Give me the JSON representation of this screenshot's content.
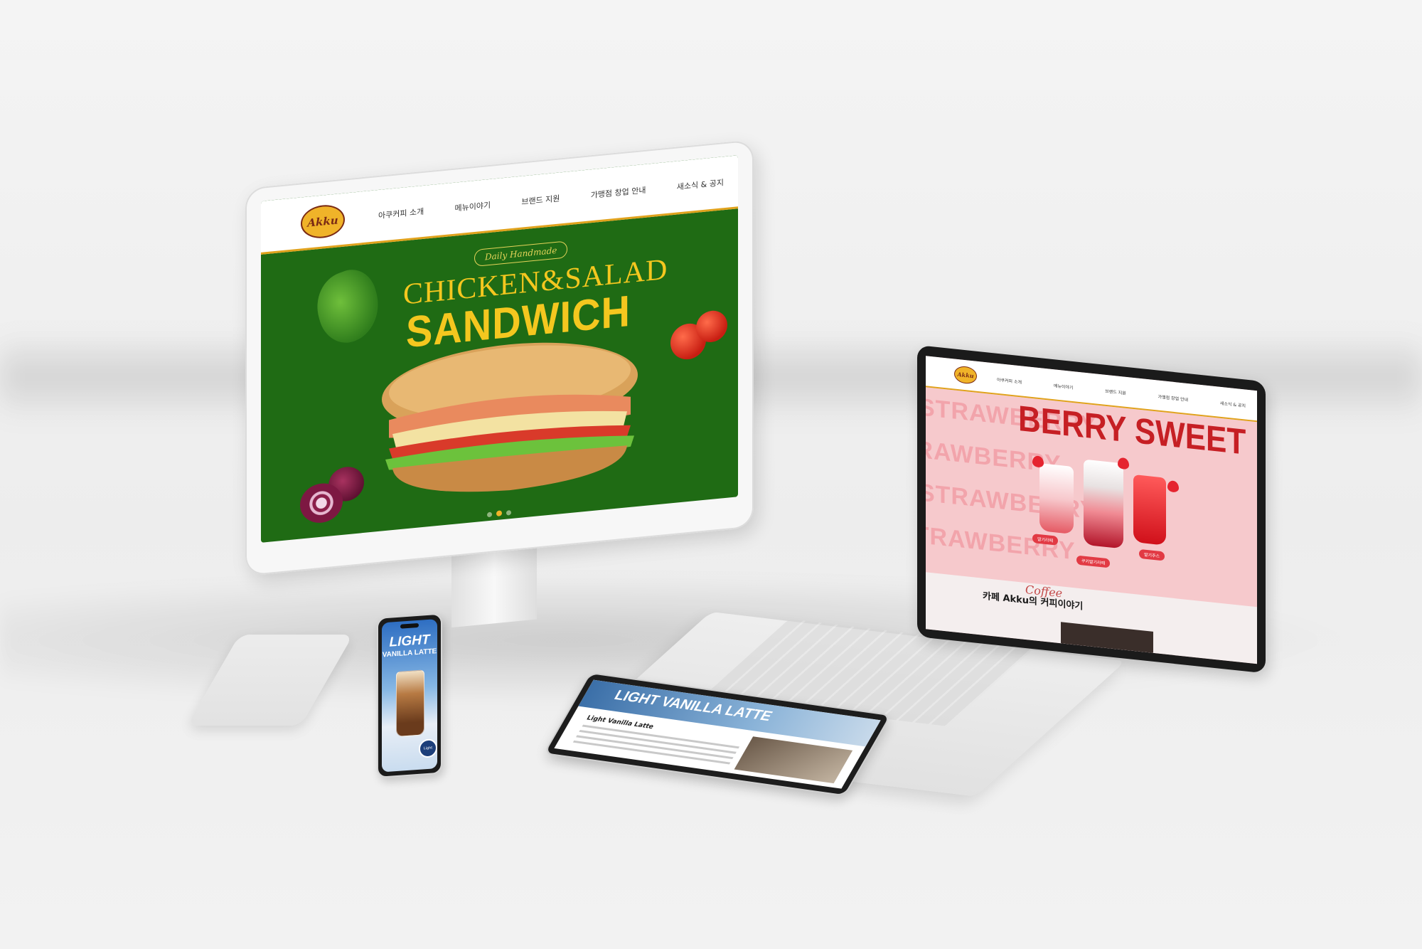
{
  "monitor": {
    "logo": "Akku",
    "menu": [
      "아쿠커피 소개",
      "메뉴이야기",
      "브랜드 지원",
      "가맹점 창업 안내",
      "새소식 & 공지"
    ],
    "tagline": "Daily Handmade",
    "title_line1": "CHICKEN&SALAD",
    "title_line2": "SANDWICH",
    "carousel_total": 3,
    "carousel_active": 2,
    "colors": {
      "bg": "#1f6b14",
      "title": "#f4c71f",
      "accent": "#e0a21c"
    }
  },
  "laptop": {
    "logo": "Akku",
    "menu": [
      "아쿠커피 소개",
      "메뉴이야기",
      "브랜드 지원",
      "가맹점 창업 안내",
      "새소식 & 공지"
    ],
    "bg_words": [
      "STRAWBERRY",
      "STRAWBERRY",
      "STRAWBERRY",
      "STRAWBERRY"
    ],
    "title": "BERRY SWEET",
    "labels": [
      "딸기라떼",
      "쿠키딸기라떼",
      "딸기주스"
    ],
    "section_title": "카페 Akku의 커피이야기",
    "section_script": "Coffee",
    "colors": {
      "bg": "#f6c9cc",
      "title": "#c61f24"
    }
  },
  "tablet": {
    "hero_text": "LIGHT VANILLA LATTE",
    "heading": "Light Vanilla Latte"
  },
  "phone": {
    "title1": "LIGHT",
    "title2": "VANILLA LATTE",
    "badge": "Light"
  }
}
